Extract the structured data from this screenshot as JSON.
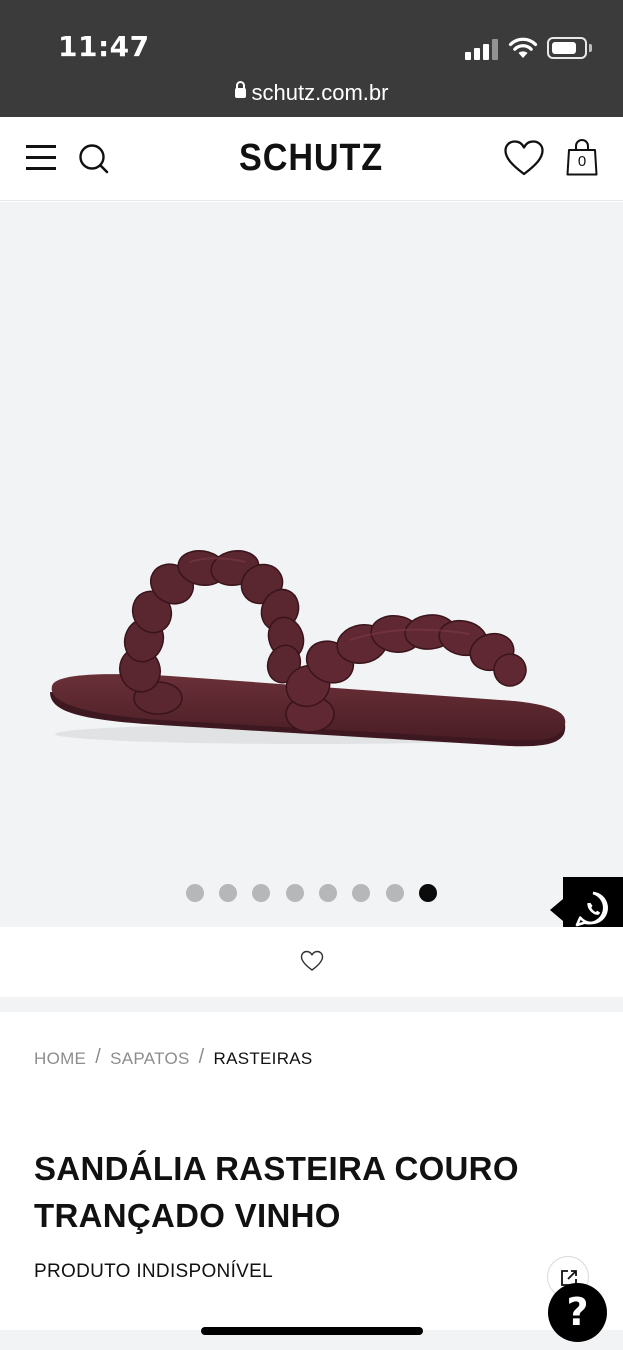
{
  "status_bar": {
    "time": "11:47",
    "url": "schutz.com.br",
    "icons": [
      "signal-icon",
      "wifi-icon",
      "battery-icon"
    ]
  },
  "header": {
    "logo": "SCHUTZ",
    "cart_count": "0",
    "icons": [
      "menu-icon",
      "search-icon",
      "heart-icon",
      "bag-icon"
    ]
  },
  "gallery": {
    "image_count": 8,
    "active_index": 7
  },
  "breadcrumb": {
    "items": [
      "HOME",
      "SAPATOS",
      "RASTEIRAS"
    ],
    "separator": "/"
  },
  "product": {
    "title_line1": "SANDÁLIA RASTEIRA COURO",
    "title_line2": "TRANÇADO VINHO",
    "status": "PRODUTO INDISPONÍVEL"
  },
  "floating": {
    "help_label": "?",
    "icons": [
      "whatsapp-icon",
      "share-icon"
    ]
  },
  "colors": {
    "status_bar": "#3b3b3b",
    "gallery_bg": "#f2f3f5",
    "product": "#5a2630",
    "accent": "#000000"
  }
}
